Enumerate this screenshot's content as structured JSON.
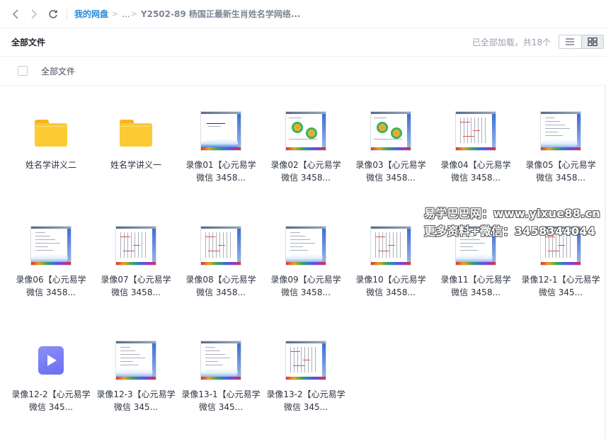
{
  "breadcrumb": {
    "root": "我的网盘",
    "ellipsis": "...",
    "current": "Y2502-89 杨国正最新生肖姓名学网络..."
  },
  "header": {
    "title": "全部文件",
    "status": "已全部加载，共18个"
  },
  "select_row": {
    "label": "全部文件"
  },
  "files": [
    {
      "type": "folder",
      "name": "姓名学讲义二"
    },
    {
      "type": "folder",
      "name": "姓名学讲义一"
    },
    {
      "type": "slide",
      "name": "录像01【心元易学 微信 3458..."
    },
    {
      "type": "slide",
      "name": "录像02【心元易学 微信 3458..."
    },
    {
      "type": "slide",
      "name": "录像03【心元易学 微信 3458..."
    },
    {
      "type": "slide",
      "name": "录像04【心元易学 微信 3458..."
    },
    {
      "type": "slide",
      "name": "录像05【心元易学 微信 3458..."
    },
    {
      "type": "slide",
      "name": "录像06【心元易学 微信 3458..."
    },
    {
      "type": "slide",
      "name": "录像07【心元易学 微信 3458..."
    },
    {
      "type": "slide",
      "name": "录像08【心元易学 微信 3458..."
    },
    {
      "type": "slide",
      "name": "录像09【心元易学 微信 3458..."
    },
    {
      "type": "slide",
      "name": "录像10【心元易学 微信 3458..."
    },
    {
      "type": "slide",
      "name": "录像11【心元易学 微信 3458..."
    },
    {
      "type": "slide",
      "name": "录像12-1【心元易学 微信 345..."
    },
    {
      "type": "video",
      "name": "录像12-2【心元易学 微信 345..."
    },
    {
      "type": "slide",
      "name": "录像12-3【心元易学 微信 345..."
    },
    {
      "type": "slide",
      "name": "录像13-1【心元易学 微信 345..."
    },
    {
      "type": "slide",
      "name": "录像13-2【心元易学 微信 345..."
    }
  ],
  "watermark": {
    "line1": "易学巴巴网：www.yixue88.cn",
    "line2": "更多资料+微信：3458344044"
  },
  "icons": {
    "back": "chevron-left-icon",
    "forward": "chevron-right-icon",
    "refresh": "refresh-icon",
    "list_view": "list-view-icon",
    "grid_view": "grid-view-icon",
    "folder": "folder-icon",
    "video": "video-file-icon"
  },
  "colors": {
    "link": "#2a8ad6",
    "folder": "#fcca33",
    "video": "#7a7ef3"
  }
}
